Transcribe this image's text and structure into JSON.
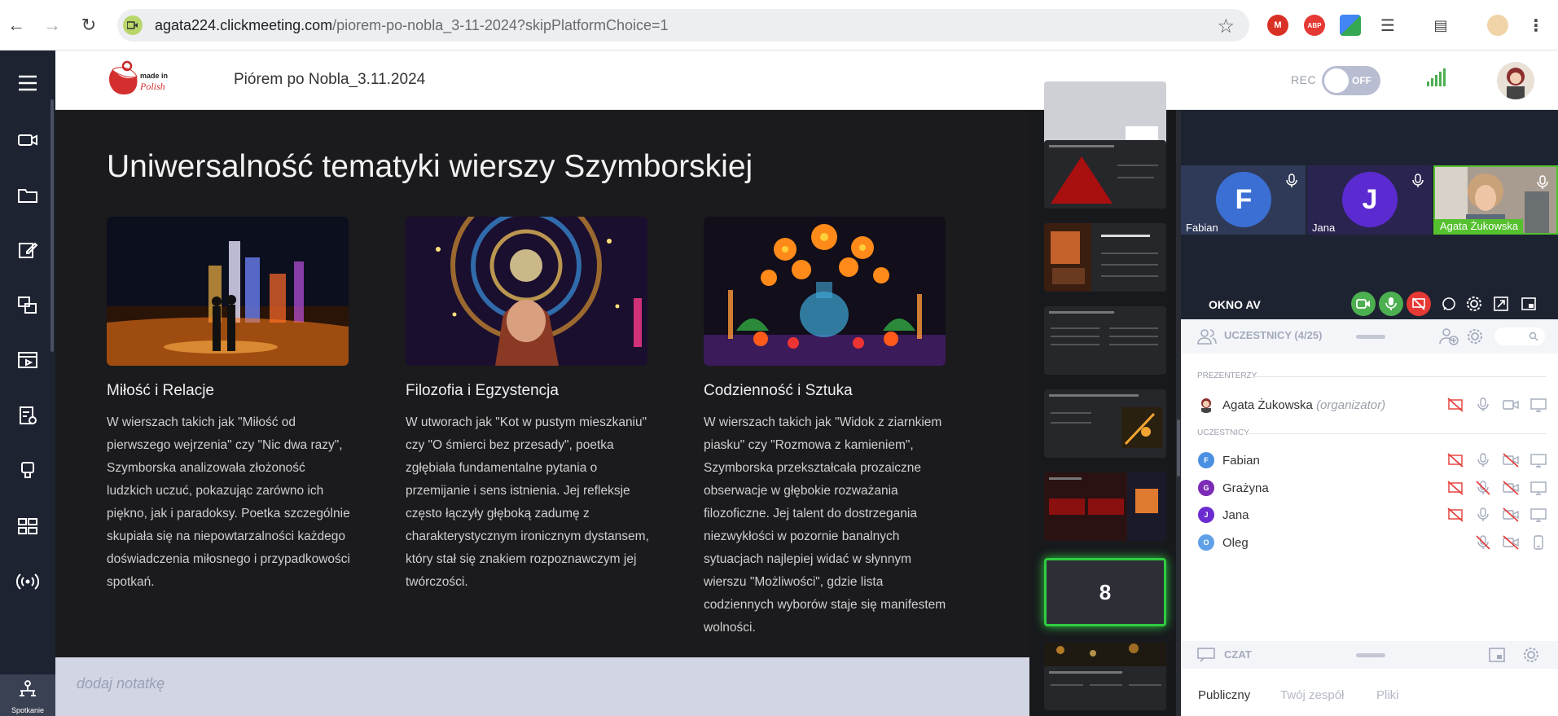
{
  "browser": {
    "url_domain": "agata224.clickmeeting.com",
    "url_path": "/piorem-po-nobla_3-11-2024?skipPlatformChoice=1",
    "extensions": [
      "M",
      "ABP"
    ]
  },
  "header": {
    "meeting_title": "Piórem po Nobla_3.11.2024",
    "rec_label": "REC",
    "rec_state": "OFF",
    "logo_text": "made in Polish"
  },
  "rail": {
    "active_label": "Spotkanie",
    "items": [
      "menu-icon",
      "video-icon",
      "folder-icon",
      "edit-icon",
      "screens-icon",
      "media-icon",
      "checklist-icon",
      "presenter-icon",
      "apps-icon",
      "broadcast-icon"
    ]
  },
  "slide": {
    "title": "Uniwersalność tematyki wierszy Szymborskiej",
    "columns": [
      {
        "heading": "Miłość i Relacje",
        "body": "W wierszach takich jak \"Miłość od pierwszego wejrzenia\" czy \"Nic dwa razy\", Szymborska analizowała złożoność ludzkich uczuć, pokazując zarówno ich piękno, jak i paradoksy. Poetka szczególnie skupiała się na niepowtarzalności każdego doświadczenia miłosnego i przypadkowości spotkań."
      },
      {
        "heading": "Filozofia i Egzystencja",
        "body": "W utworach jak \"Kot w pustym mieszkaniu\" czy \"O śmierci bez przesady\", poetka zgłębiała fundamentalne pytania o przemijanie i sens istnienia. Jej refleksje często łączyły głęboką zadumę z charakterystycznym ironicznym dystansem, który stał się znakiem rozpoznawczym jej twórczości."
      },
      {
        "heading": "Codzienność i Sztuka",
        "body": "W wierszach takich jak \"Widok z ziarnkiem piasku\" czy \"Rozmowa z kamieniem\", Szymborska przekształcała prozaiczne obserwacje w głębokie rozważania filozoficzne. Jej talent do dostrzegania niezwykłości w pozornie banalnych sytuacjach najlepiej widać w słynnym wierszu \"Możliwości\", gdzie lista codziennych wyborów staje się manifestem wolności."
      }
    ]
  },
  "note": {
    "placeholder": "dodaj notatkę"
  },
  "thumbnails": {
    "active_number": "8"
  },
  "av": {
    "label": "OKNO AV",
    "tiles": [
      {
        "name": "Fabian",
        "initial": "F",
        "color": "#3b6fd4"
      },
      {
        "name": "Jana",
        "initial": "J",
        "color": "#5b2bd1"
      },
      {
        "name": "Agata Żukowska",
        "initial": "",
        "color": "#55c12e"
      }
    ]
  },
  "participants": {
    "title": "UCZESTNICY (4/25)",
    "presenters_label": "PREZENTERZY",
    "attendees_label": "UCZESTNICY",
    "presenter": {
      "name": "Agata Żukowska",
      "role": "(organizator)"
    },
    "attendees": [
      {
        "name": "Fabian",
        "initial": "F",
        "color": "#4a90e2"
      },
      {
        "name": "Grażyna",
        "initial": "G",
        "color": "#7b2bb5"
      },
      {
        "name": "Jana",
        "initial": "J",
        "color": "#6a2bd1"
      },
      {
        "name": "Oleg",
        "initial": "O",
        "color": "#5fa0e8"
      }
    ]
  },
  "chat": {
    "title": "CZAT",
    "tabs": [
      "Publiczny",
      "Twój zespół",
      "Pliki"
    ]
  }
}
